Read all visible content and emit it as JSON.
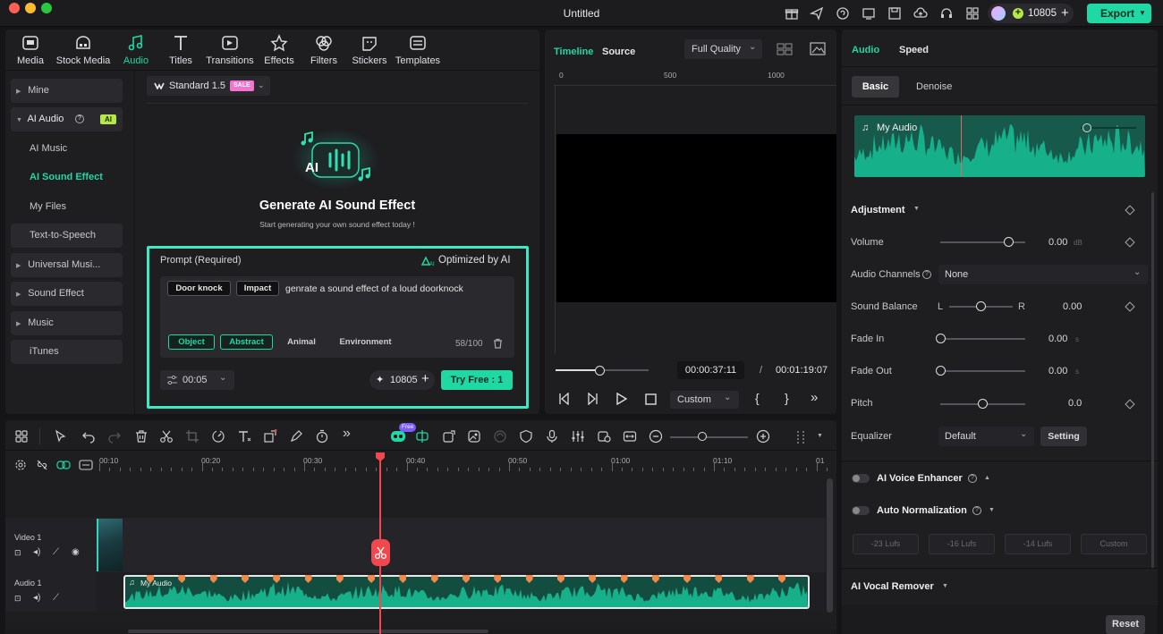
{
  "window": {
    "title": "Untitled",
    "credits": "10805",
    "export_label": "Export"
  },
  "toolbar": {
    "tabs": [
      {
        "label": "Media"
      },
      {
        "label": "Stock Media"
      },
      {
        "label": "Audio"
      },
      {
        "label": "Titles"
      },
      {
        "label": "Transitions"
      },
      {
        "label": "Effects"
      },
      {
        "label": "Filters"
      },
      {
        "label": "Stickers"
      },
      {
        "label": "Templates"
      }
    ]
  },
  "sidebar": {
    "items": [
      {
        "label": "Mine"
      },
      {
        "label": "AI Audio",
        "badge": "AI"
      },
      {
        "label": "AI Music"
      },
      {
        "label": "AI Sound Effect"
      },
      {
        "label": "My Files"
      },
      {
        "label": "Text-to-Speech"
      },
      {
        "label": "Universal Musi..."
      },
      {
        "label": "Sound Effect"
      },
      {
        "label": "Music"
      },
      {
        "label": "iTunes"
      }
    ]
  },
  "generator": {
    "model": "Standard 1.5",
    "sale_badge": "SALE",
    "title": "Generate AI Sound Effect",
    "subtitle": "Start generating your own sound effect today !",
    "prompt_label": "Prompt (Required)",
    "optimized_label": "Optimized by AI",
    "tag_chips": [
      "Door knock",
      "Impact"
    ],
    "prompt_text": "genrate a sound effect of a loud doorknock",
    "categories": [
      "Object",
      "Abstract",
      "Animal",
      "Environment"
    ],
    "char_count": "58/100",
    "duration": "00:05",
    "credits": "10805",
    "try_label": "Try Free : 1"
  },
  "preview": {
    "tabs": [
      "Timeline",
      "Source"
    ],
    "quality": "Full Quality",
    "ruler": [
      "0",
      "500",
      "1000"
    ],
    "current_time": "00:00:37:11",
    "separator": "/",
    "total_time": "00:01:19:07",
    "zoom_mode": "Custom",
    "progress": 0.48
  },
  "right_panel": {
    "tabs": [
      "Audio",
      "Speed"
    ],
    "subtabs": [
      "Basic",
      "Denoise"
    ],
    "clip_name": "My Audio",
    "adjustment_label": "Adjustment",
    "volume": {
      "label": "Volume",
      "value": "0.00",
      "unit": "dB",
      "level": 0.8
    },
    "channels": {
      "label": "Audio Channels",
      "value": "None"
    },
    "balance": {
      "label": "Sound Balance",
      "left": "L",
      "right": "R",
      "value": "0.00",
      "level": 0.5
    },
    "fade_in": {
      "label": "Fade In",
      "value": "0.00",
      "unit": "s",
      "level": 0
    },
    "fade_out": {
      "label": "Fade Out",
      "value": "0.00",
      "unit": "s",
      "level": 0
    },
    "pitch": {
      "label": "Pitch",
      "value": "0.0",
      "level": 0.5
    },
    "equalizer": {
      "label": "Equalizer",
      "value": "Default",
      "setting_label": "Setting"
    },
    "voice_enhancer": "AI Voice Enhancer",
    "auto_normalization": "Auto Normalization",
    "norm_options": [
      "-23 Lufs",
      "-16 Lufs",
      "-14 Lufs",
      "Custom"
    ],
    "vocal_remover": "AI Vocal Remover",
    "reset_label": "Reset"
  },
  "timeline": {
    "ruler": [
      "00:10",
      "00:20",
      "00:30",
      "00:40",
      "00:50",
      "01:00",
      "01:10",
      "01"
    ],
    "free_badge": "Free",
    "tracks": [
      {
        "label": "Video 1"
      },
      {
        "label": "Audio 1",
        "clip": "My Audio"
      }
    ]
  },
  "colors": {
    "accent": "#1fd8a4",
    "playhead": "#f0484e",
    "wave": "#16b08a",
    "marker": "#f08a4b"
  }
}
